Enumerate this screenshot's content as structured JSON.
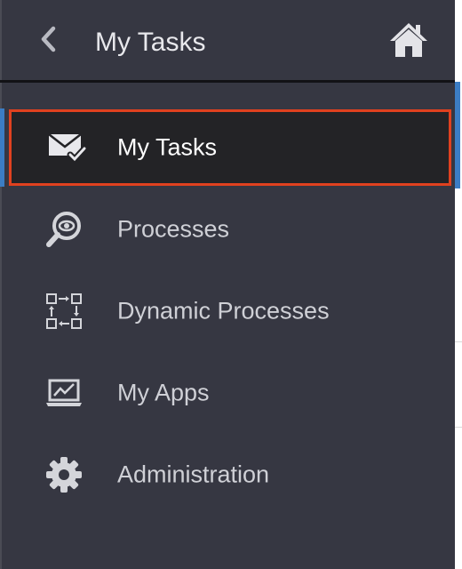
{
  "header": {
    "title": "My Tasks",
    "back_icon": "chevron-left-icon",
    "home_icon": "home-icon"
  },
  "nav": {
    "items": [
      {
        "label": "My Tasks",
        "icon": "envelope-check-icon",
        "active": true
      },
      {
        "label": "Processes",
        "icon": "magnifier-eye-icon",
        "active": false
      },
      {
        "label": "Dynamic Processes",
        "icon": "process-flow-icon",
        "active": false
      },
      {
        "label": "My Apps",
        "icon": "laptop-chart-icon",
        "active": false
      },
      {
        "label": "Administration",
        "icon": "gear-icon",
        "active": false
      }
    ]
  },
  "colors": {
    "panel_bg": "#363742",
    "active_bg": "#232326",
    "active_border": "#e0411f",
    "accent_blue": "#3c7dc4",
    "text": "#cfd0d6",
    "text_active": "#ffffff"
  }
}
